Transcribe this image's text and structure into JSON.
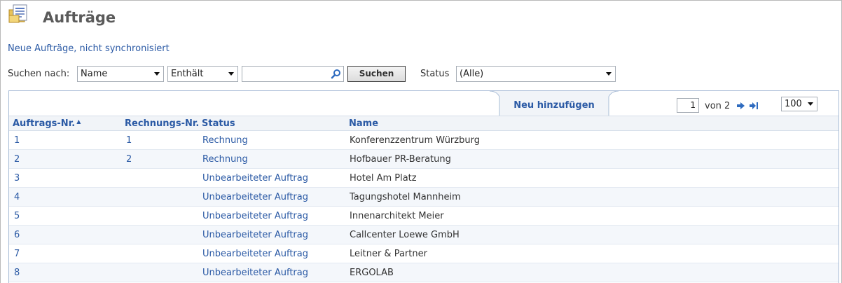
{
  "header": {
    "title": "Aufträge",
    "icon": "orders-document-icon"
  },
  "sync_link": "Neue Aufträge, nicht synchronisiert",
  "search": {
    "label": "Suchen nach:",
    "field_select": "Name",
    "operator_select": "Enthält",
    "query_value": "",
    "button_label": "Suchen",
    "status_label": "Status",
    "status_select": "(Alle)"
  },
  "toolbar": {
    "add_label": "Neu hinzufügen",
    "page_current": "1",
    "page_of_label": "von 2",
    "page_size": "100"
  },
  "table": {
    "headers": {
      "order_no": "Auftrags-Nr.",
      "invoice_no": "Rechnungs-Nr.",
      "status": "Status",
      "name": "Name"
    },
    "sort_indicator": "▲",
    "rows": [
      {
        "order_no": "1",
        "invoice_no": "1",
        "status": "Rechnung",
        "name": "Konferenzzentrum Würzburg"
      },
      {
        "order_no": "2",
        "invoice_no": "2",
        "status": "Rechnung",
        "name": "Hofbauer PR-Beratung"
      },
      {
        "order_no": "3",
        "invoice_no": "",
        "status": "Unbearbeiteter Auftrag",
        "name": "Hotel Am Platz"
      },
      {
        "order_no": "4",
        "invoice_no": "",
        "status": "Unbearbeiteter Auftrag",
        "name": "Tagungshotel Mannheim"
      },
      {
        "order_no": "5",
        "invoice_no": "",
        "status": "Unbearbeiteter Auftrag",
        "name": "Innenarchitekt Meier"
      },
      {
        "order_no": "6",
        "invoice_no": "",
        "status": "Unbearbeiteter Auftrag",
        "name": "Callcenter Loewe GmbH"
      },
      {
        "order_no": "7",
        "invoice_no": "",
        "status": "Unbearbeiteter Auftrag",
        "name": "Leitner & Partner"
      },
      {
        "order_no": "8",
        "invoice_no": "",
        "status": "Unbearbeiteter Auftrag",
        "name": "ERGOLAB"
      }
    ]
  },
  "colors": {
    "link": "#2b5aa5",
    "panel_border": "#a8bcd6",
    "alt_row": "#f4f7fb"
  }
}
